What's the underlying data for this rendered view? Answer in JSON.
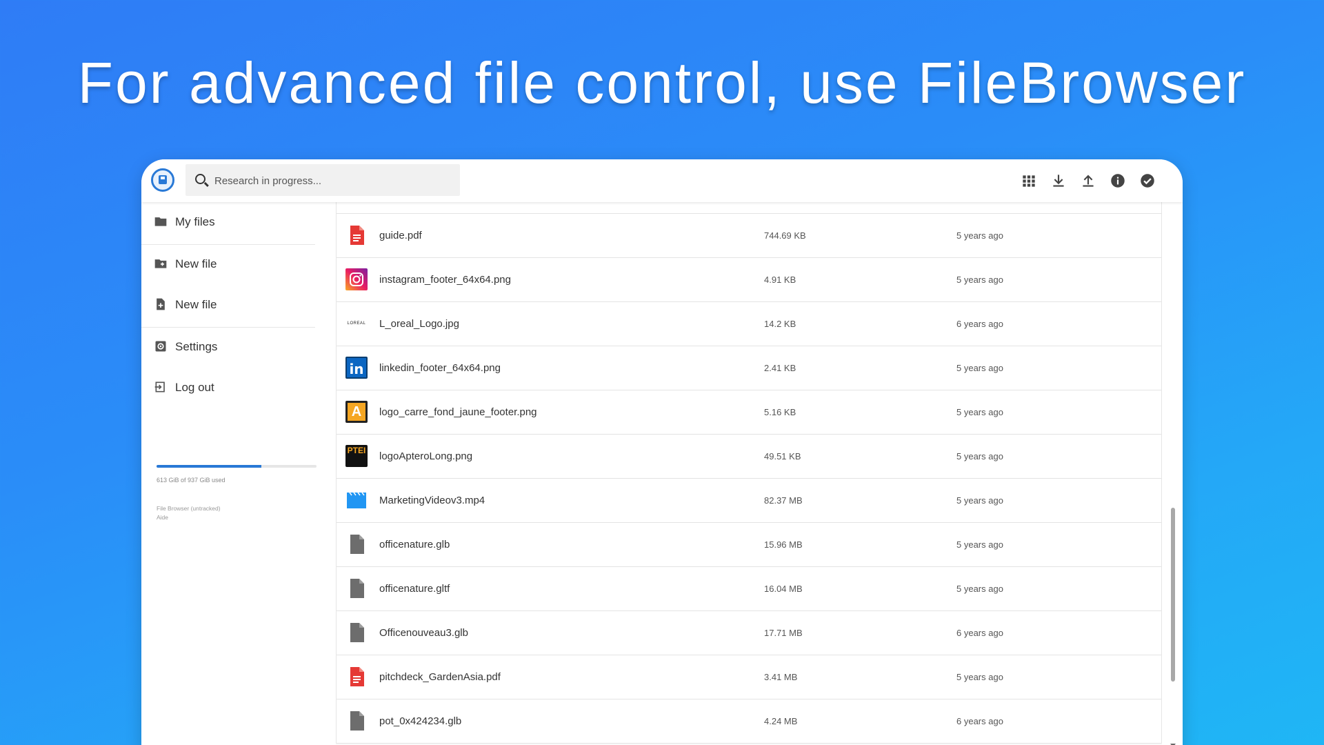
{
  "headline": "For advanced file control, use FileBrowser",
  "colors": {
    "accent": "#2979d6",
    "pdf_red": "#e53935",
    "file_gray": "#6d6d6d",
    "video_blue": "#2196f3"
  },
  "topbar": {
    "logo": "floppy-disk-icon",
    "search_placeholder": "Research in progress...",
    "actions": [
      {
        "name": "grid-view-icon"
      },
      {
        "name": "download-icon"
      },
      {
        "name": "upload-icon"
      },
      {
        "name": "info-icon"
      },
      {
        "name": "select-check-icon"
      }
    ]
  },
  "sidebar": {
    "items": [
      {
        "label": "My files",
        "icon": "folder-icon"
      },
      {
        "label": "New file",
        "icon": "new-folder-icon"
      },
      {
        "label": "New file",
        "icon": "new-file-icon"
      },
      {
        "label": "Settings",
        "icon": "settings-icon"
      },
      {
        "label": "Log out",
        "icon": "logout-icon"
      }
    ],
    "usage": {
      "fraction": 0.654,
      "text": "613 GiB of 937 GiB used"
    },
    "credits": [
      "File Browser (untracked)",
      "Aide"
    ]
  },
  "files": [
    {
      "name": "guide.pdf",
      "size": "744.69 KB",
      "modified": "5 years ago",
      "type": "pdf"
    },
    {
      "name": "instagram_footer_64x64.png",
      "size": "4.91 KB",
      "modified": "5 years ago",
      "type": "instagram"
    },
    {
      "name": "L_oreal_Logo.jpg",
      "size": "14.2 KB",
      "modified": "6 years ago",
      "type": "loreal",
      "thumb_text": "LOREAL"
    },
    {
      "name": "linkedin_footer_64x64.png",
      "size": "2.41 KB",
      "modified": "5 years ago",
      "type": "linkedin",
      "thumb_text": "in"
    },
    {
      "name": "logo_carre_fond_jaune_footer.png",
      "size": "5.16 KB",
      "modified": "5 years ago",
      "type": "apterotile",
      "thumb_text": "A"
    },
    {
      "name": "logoApteroLong.png",
      "size": "49.51 KB",
      "modified": "5 years ago",
      "type": "apterolong",
      "thumb_text": "PTEI"
    },
    {
      "name": "MarketingVideov3.mp4",
      "size": "82.37 MB",
      "modified": "5 years ago",
      "type": "video"
    },
    {
      "name": "officenature.glb",
      "size": "15.96 MB",
      "modified": "5 years ago",
      "type": "file"
    },
    {
      "name": "officenature.gltf",
      "size": "16.04 MB",
      "modified": "5 years ago",
      "type": "file"
    },
    {
      "name": "Officenouveau3.glb",
      "size": "17.71 MB",
      "modified": "6 years ago",
      "type": "file"
    },
    {
      "name": "pitchdeck_GardenAsia.pdf",
      "size": "3.41 MB",
      "modified": "5 years ago",
      "type": "pdf"
    },
    {
      "name": "pot_0x424234.glb",
      "size": "4.24 MB",
      "modified": "6 years ago",
      "type": "file"
    }
  ]
}
